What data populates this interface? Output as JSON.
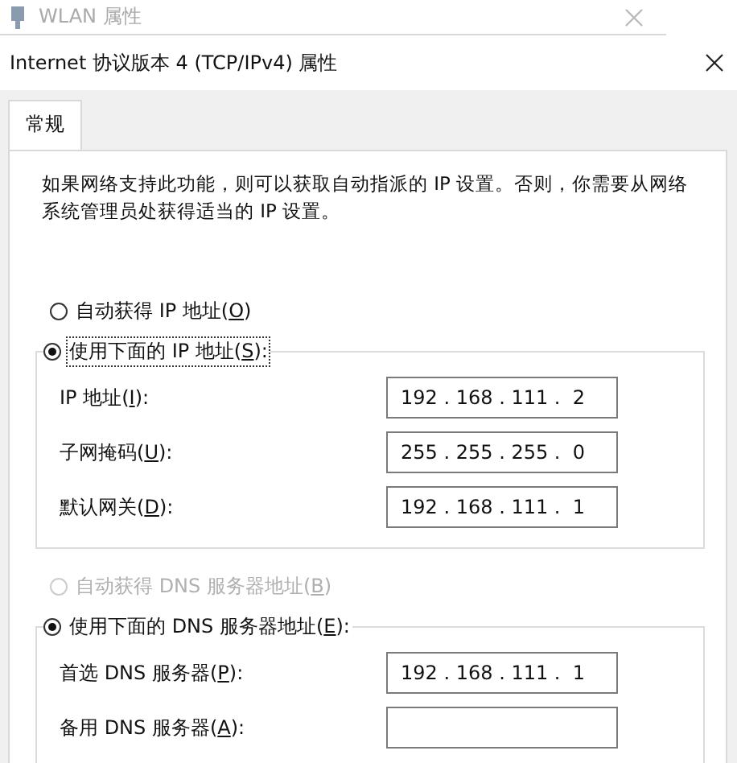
{
  "background_window": {
    "title": "WLAN 属性"
  },
  "dialog": {
    "title": "Internet 协议版本 4 (TCP/IPv4) 属性"
  },
  "tabs": [
    {
      "label": "常规",
      "selected": true
    }
  ],
  "description": "如果网络支持此功能，则可以获取自动指派的 IP 设置。否则，你需要从网络系统管理员处获得适当的 IP 设置。",
  "sections": [
    {
      "auto_option": {
        "before": "自动获得 IP 地址(",
        "key": "O",
        "after": ")",
        "selected": false,
        "disabled": false
      },
      "manual_option": {
        "before": "使用下面的 IP 地址(",
        "key": "S",
        "after": "):",
        "selected": true,
        "disabled": false,
        "focused": true
      },
      "fields": [
        {
          "before": "IP 地址(",
          "key": "I",
          "after": "):",
          "value": "192 . 168 . 111 .  2"
        },
        {
          "before": "子网掩码(",
          "key": "U",
          "after": "):",
          "value": "255 . 255 . 255 .  0"
        },
        {
          "before": "默认网关(",
          "key": "D",
          "after": "):",
          "value": "192 . 168 . 111 .  1"
        }
      ]
    },
    {
      "auto_option": {
        "before": "自动获得 DNS 服务器地址(",
        "key": "B",
        "after": ")",
        "selected": false,
        "disabled": true
      },
      "manual_option": {
        "before": "使用下面的 DNS 服务器地址(",
        "key": "E",
        "after": "):",
        "selected": true,
        "disabled": false,
        "focused": false
      },
      "fields": [
        {
          "before": "首选 DNS 服务器(",
          "key": "P",
          "after": "):",
          "value": "192 . 168 . 111 .  1"
        },
        {
          "before": "备用 DNS 服务器(",
          "key": "A",
          "after": "):"
        }
      ]
    }
  ]
}
